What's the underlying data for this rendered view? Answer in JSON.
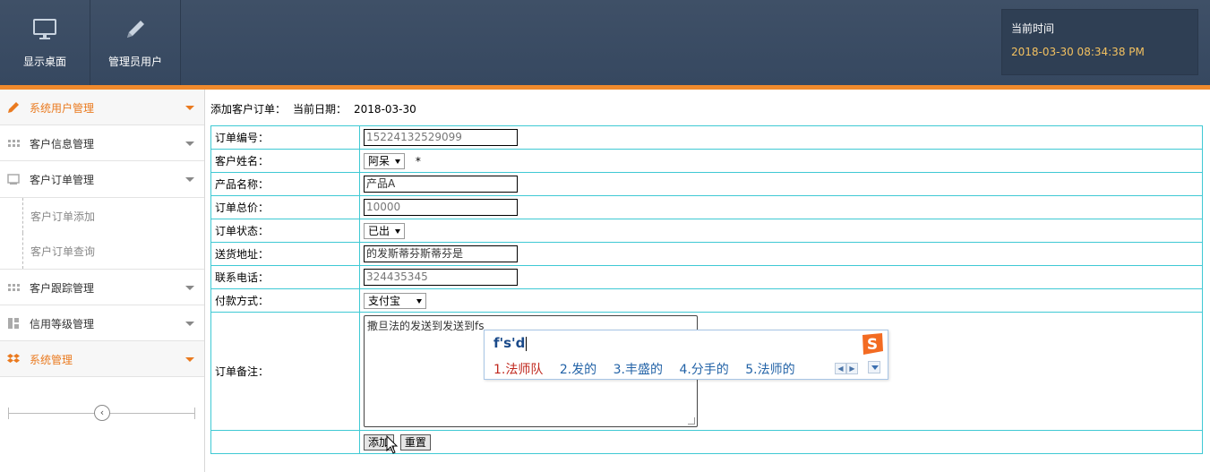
{
  "header": {
    "buttons": [
      {
        "label": "显示桌面",
        "icon": "monitor-icon"
      },
      {
        "label": "管理员用户",
        "icon": "pencil-icon"
      }
    ],
    "time_label": "当前时间",
    "time_value": "2018-03-30 08:34:38 PM",
    "accent": "#f08a2c"
  },
  "sidebar": {
    "items": [
      {
        "label": "系统用户管理",
        "icon": "pencil-icon"
      },
      {
        "label": "客户信息管理",
        "icon": "grid-icon"
      },
      {
        "label": "客户订单管理",
        "icon": "screen-icon"
      },
      {
        "label": "客户订单添加"
      },
      {
        "label": "客户订单查询"
      },
      {
        "label": "客户跟踪管理",
        "icon": "grid-icon"
      },
      {
        "label": "信用等级管理",
        "icon": "layout-icon"
      },
      {
        "label": "系统管理",
        "icon": "dropbox-icon"
      }
    ],
    "collapse_symbol": "‹"
  },
  "main": {
    "title": "添加客户订单：",
    "date_label": "当前日期：",
    "date_value": "2018-03-30",
    "fields": {
      "order_no": {
        "label": "订单编号：",
        "value": "15224132529099"
      },
      "customer": {
        "label": "客户姓名：",
        "value": "阿呆",
        "required": "*"
      },
      "product": {
        "label": "产品名称：",
        "value": "产品A"
      },
      "total": {
        "label": "订单总价：",
        "value": "10000"
      },
      "status": {
        "label": "订单状态：",
        "value": "已出"
      },
      "address": {
        "label": "送货地址：",
        "value": "的发斯蒂芬斯蒂芬是"
      },
      "phone": {
        "label": "联系电话：",
        "value": "324435345"
      },
      "payment": {
        "label": "付款方式：",
        "value": "支付宝"
      },
      "remark": {
        "label": "订单备注：",
        "value": "撒旦法的发送到发送到fs"
      }
    },
    "buttons": {
      "add": "添加",
      "reset": "重置"
    }
  },
  "ime": {
    "composition": "f's'd",
    "candidates": [
      "1.法师队",
      "2.发的",
      "3.丰盛的",
      "4.分手的",
      "5.法师的"
    ],
    "logo": "S"
  }
}
